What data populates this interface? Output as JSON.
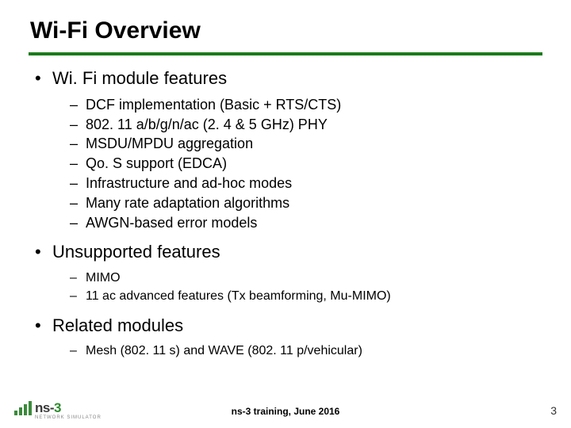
{
  "title": "Wi-Fi Overview",
  "sections": [
    {
      "heading": "Wi. Fi module features",
      "items": [
        "DCF implementation (Basic + RTS/CTS)",
        "802. 11 a/b/g/n/ac (2. 4 & 5 GHz) PHY",
        "MSDU/MPDU aggregation",
        "Qo. S support (EDCA)",
        "Infrastructure and ad-hoc modes",
        "Many rate adaptation algorithms",
        "AWGN-based error models"
      ]
    },
    {
      "heading": "Unsupported features",
      "items": [
        "MIMO",
        "11 ac advanced features (Tx beamforming, Mu-MIMO)"
      ]
    },
    {
      "heading": "Related modules",
      "items": [
        "Mesh (802. 11 s) and WAVE (802. 11 p/vehicular)"
      ]
    }
  ],
  "footer": {
    "center": "ns-3 training, June 2016",
    "page": "3",
    "logo_main_pre": "ns-",
    "logo_main_post": "3",
    "logo_sub": "NETWORK SIMULATOR"
  }
}
